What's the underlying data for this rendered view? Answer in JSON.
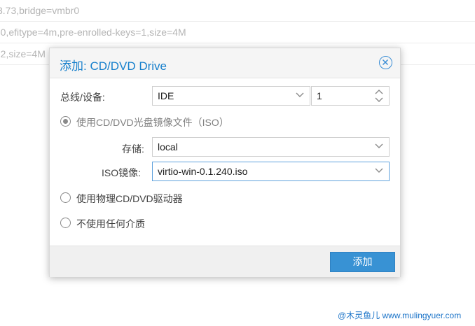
{
  "background": {
    "rows": [
      "3.73,bridge=vmbr0",
      "-0,efitype=4m,pre-enrolled-keys=1,size=4M",
      "-2,size=4M"
    ]
  },
  "dialog": {
    "title": "添加: CD/DVD Drive",
    "close_icon": "close-circle-icon",
    "bus_device": {
      "label": "总线/设备:",
      "bus_value": "IDE",
      "device_value": "1"
    },
    "media_options": {
      "use_iso_label": "使用CD/DVD光盘镜像文件（ISO）",
      "use_iso_checked": true,
      "storage_label": "存储:",
      "storage_value": "local",
      "iso_label": "ISO镜像:",
      "iso_value": "virtio-win-0.1.240.iso",
      "use_physical_label": "使用物理CD/DVD驱动器",
      "use_physical_checked": false,
      "no_media_label": "不使用任何介质",
      "no_media_checked": false
    },
    "footer": {
      "add_label": "添加"
    }
  },
  "watermark": "@木灵鱼儿 www.mulingyuer.com",
  "colors": {
    "accent": "#157fcc",
    "button_bg": "#3892d4",
    "focus_border": "#5fa2dd"
  }
}
